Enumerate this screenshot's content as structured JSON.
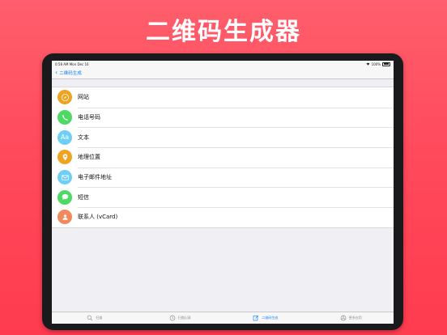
{
  "hero": {
    "title": "二维码生成器"
  },
  "status": {
    "time": "0:58 AM",
    "date": "Mon Dec 16",
    "battery": "100%"
  },
  "nav": {
    "back_label": "二维码生成"
  },
  "items": [
    {
      "label": "网站",
      "icon": "globe-icon",
      "color": "#f0a321"
    },
    {
      "label": "电话号码",
      "icon": "phone-icon",
      "color": "#4cd964"
    },
    {
      "label": "文本",
      "icon": "text-icon",
      "text": "Aa",
      "color": "#6ecff6"
    },
    {
      "label": "地理位置",
      "icon": "location-pin-icon",
      "color": "#f0a321"
    },
    {
      "label": "电子邮件地址",
      "icon": "mail-icon",
      "color": "#6ecff6"
    },
    {
      "label": "短信",
      "icon": "message-icon",
      "color": "#4cd964"
    },
    {
      "label": "联系人 (vCard)",
      "icon": "contact-icon",
      "color": "#f08a5d"
    }
  ],
  "tabs": [
    {
      "label": "扫描",
      "icon": "search-icon",
      "active": false
    },
    {
      "label": "扫描记录",
      "icon": "history-icon",
      "active": false
    },
    {
      "label": "二维码生成",
      "icon": "compose-icon",
      "active": true
    },
    {
      "label": "更多应用",
      "icon": "apps-icon",
      "active": false
    }
  ],
  "colors": {
    "accent": "#147efb",
    "background": "#ff4a5c"
  }
}
